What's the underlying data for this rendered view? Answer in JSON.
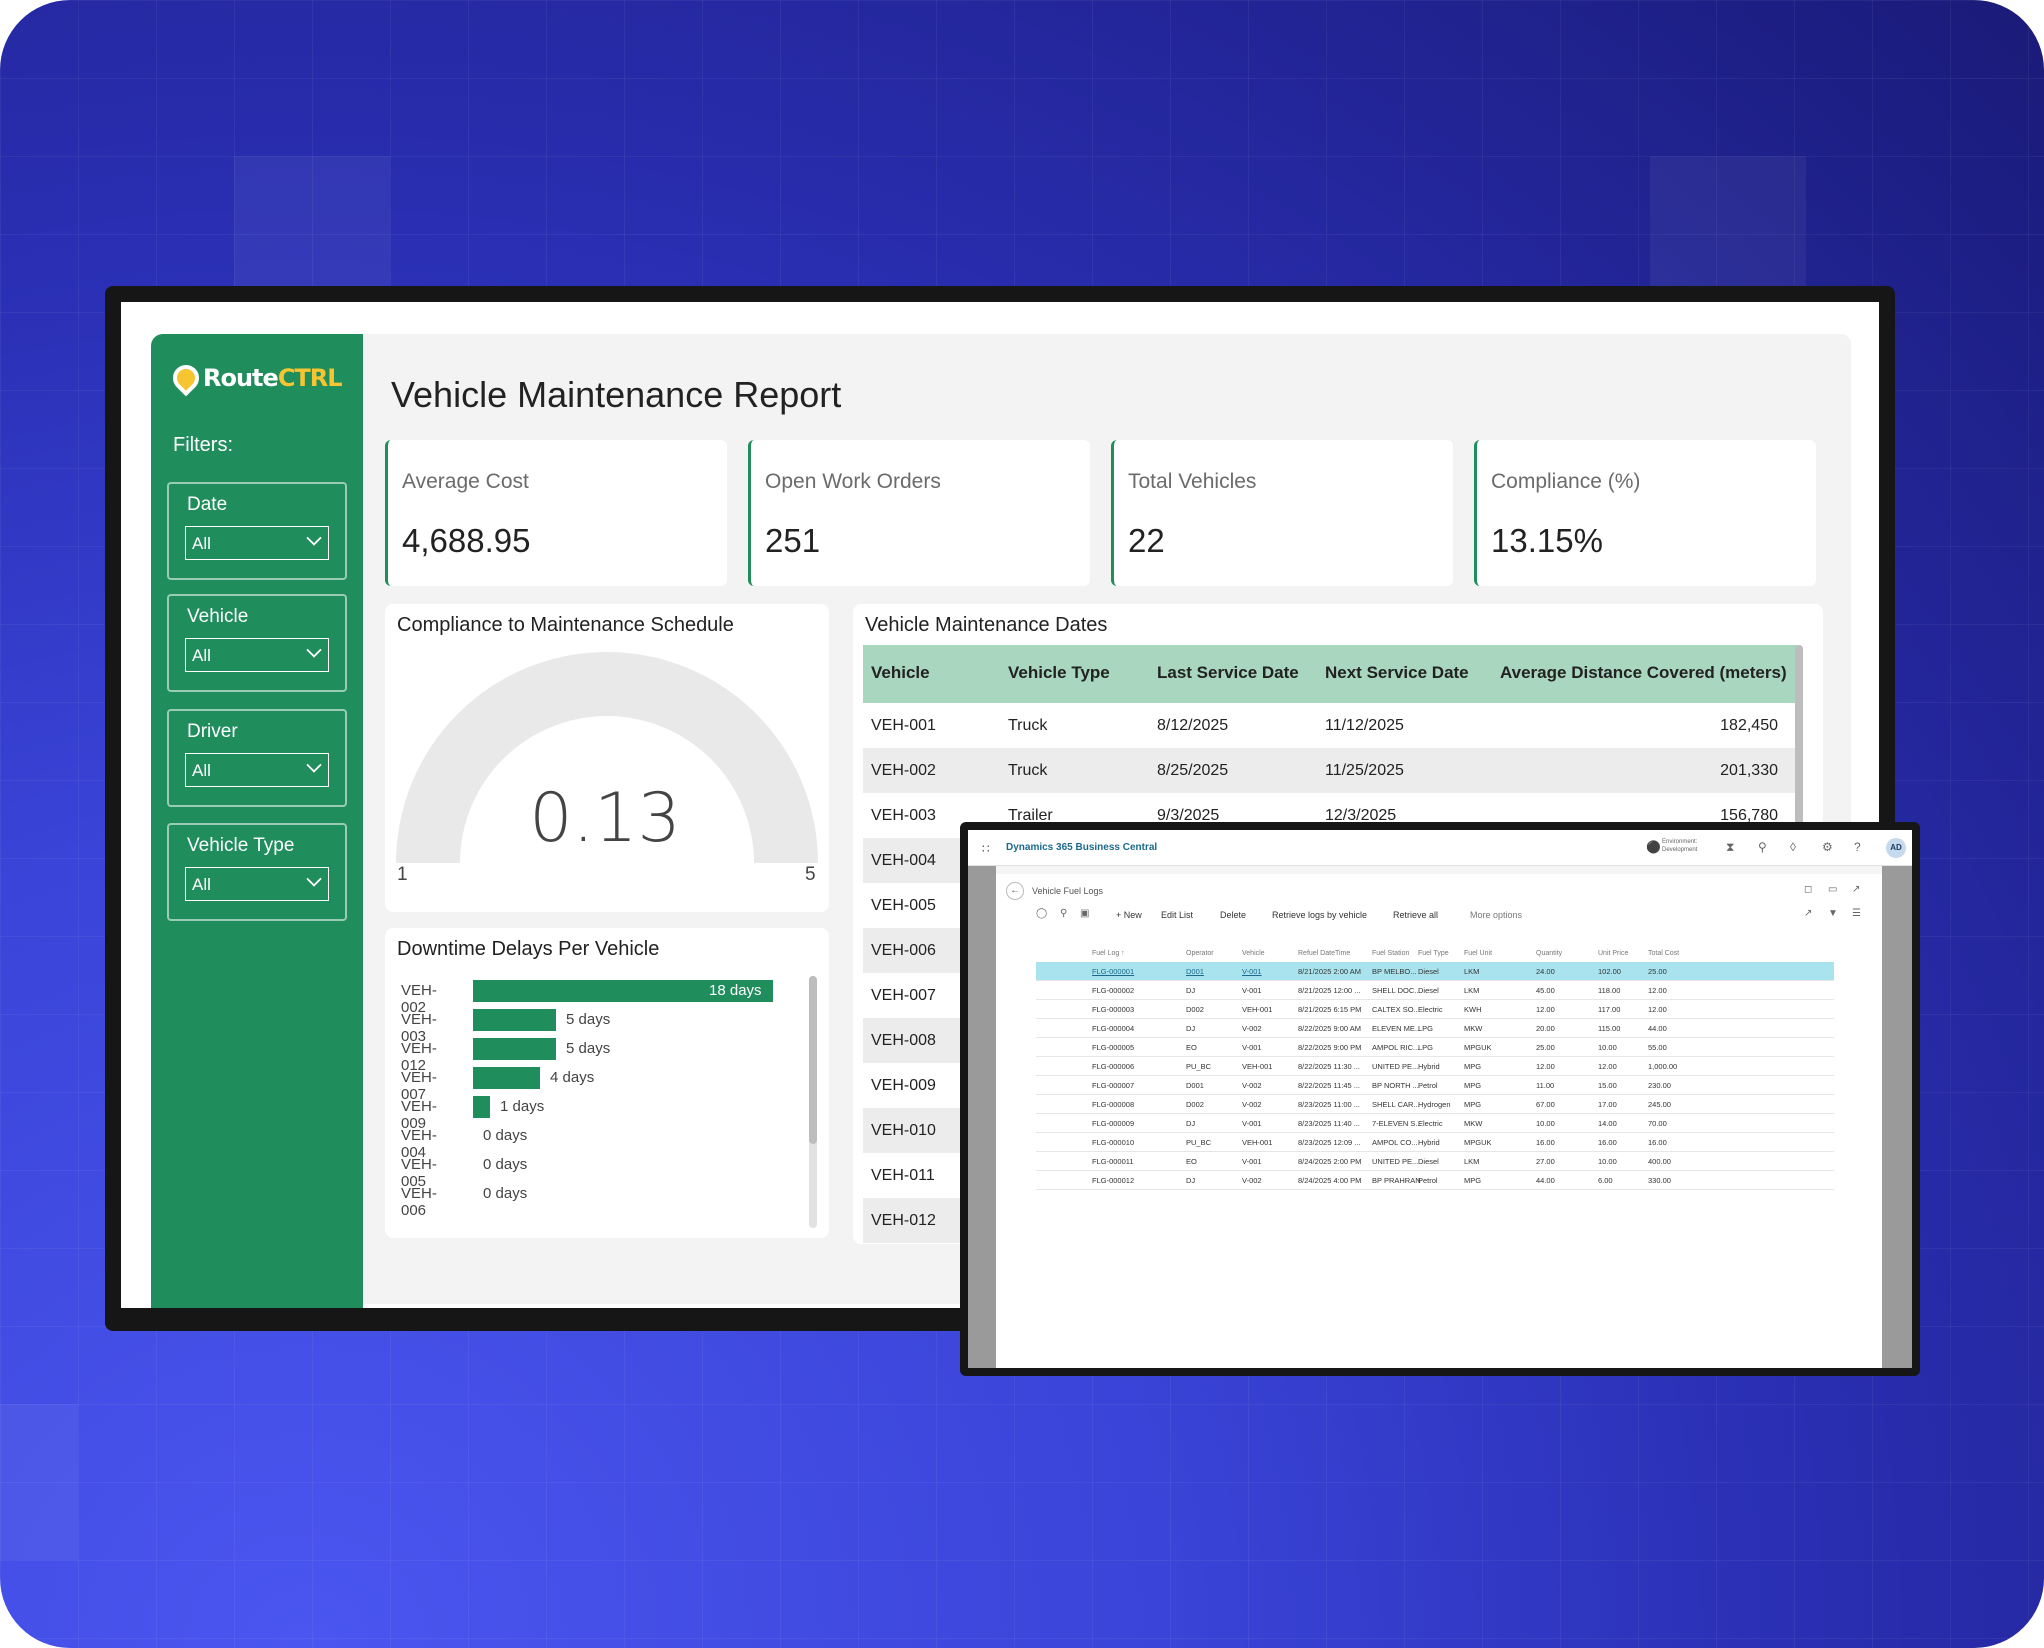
{
  "app": {
    "logo_route": "Route",
    "logo_ctrl": "CTRL",
    "report_title": "Vehicle Maintenance Report"
  },
  "colors": {
    "brand_green": "#1f8d5c",
    "table_header": "#a8d6bf",
    "background_blue": "#2a2fb4",
    "bc_selected_row": "#a9e3ee"
  },
  "filters": {
    "heading": "Filters:",
    "items": [
      {
        "label": "Date",
        "value": "All"
      },
      {
        "label": "Vehicle",
        "value": "All"
      },
      {
        "label": "Driver",
        "value": "All"
      },
      {
        "label": "Vehicle Type",
        "value": "All"
      }
    ]
  },
  "kpis": [
    {
      "label": "Average Cost",
      "value": "4,688.95"
    },
    {
      "label": "Open Work Orders",
      "value": "251"
    },
    {
      "label": "Total Vehicles",
      "value": "22"
    },
    {
      "label": "Compliance (%)",
      "value": "13.15%"
    }
  ],
  "gauge": {
    "title": "Compliance to Maintenance Schedule",
    "value": "0.13",
    "min": "1",
    "max": "5"
  },
  "chart_data": {
    "type": "bar",
    "title": "Downtime Delays Per Vehicle",
    "orientation": "horizontal",
    "categories": [
      "VEH-002",
      "VEH-003",
      "VEH-012",
      "VEH-007",
      "VEH-009",
      "VEH-004",
      "VEH-005",
      "VEH-006"
    ],
    "values": [
      18,
      5,
      5,
      4,
      1,
      0,
      0,
      0
    ],
    "data_labels": [
      "18 days",
      "5 days",
      "5 days",
      "4 days",
      "1 days",
      "0 days",
      "0 days",
      "0 days"
    ],
    "xlim": [
      0,
      18
    ]
  },
  "maintenance_table": {
    "title": "Vehicle Maintenance Dates",
    "columns": [
      "Vehicle",
      "Vehicle Type",
      "Last Service Date",
      "Next Service Date",
      "Average Distance Covered (meters)"
    ],
    "rows": [
      [
        "VEH-001",
        "Truck",
        "8/12/2025",
        "11/12/2025",
        "182,450"
      ],
      [
        "VEH-002",
        "Truck",
        "8/25/2025",
        "11/25/2025",
        "201,330"
      ],
      [
        "VEH-003",
        "Trailer",
        "9/3/2025",
        "12/3/2025",
        "156,780"
      ],
      [
        "VEH-004",
        "",
        "",
        "",
        ""
      ],
      [
        "VEH-005",
        "",
        "",
        "",
        ""
      ],
      [
        "VEH-006",
        "",
        "",
        "",
        ""
      ],
      [
        "VEH-007",
        "",
        "",
        "",
        ""
      ],
      [
        "VEH-008",
        "",
        "",
        "",
        ""
      ],
      [
        "VEH-009",
        "",
        "",
        "",
        ""
      ],
      [
        "VEH-010",
        "",
        "",
        "",
        ""
      ],
      [
        "VEH-011",
        "",
        "",
        "",
        ""
      ],
      [
        "VEH-012",
        "",
        "",
        "",
        ""
      ]
    ]
  },
  "bc": {
    "app_name": "Dynamics 365 Business Central",
    "env": [
      "Environment:",
      "Development"
    ],
    "avatar": "AD",
    "page_name": "Vehicle Fuel Logs",
    "actions": [
      "+ New",
      "Edit List",
      "Delete",
      "Retrieve logs by vehicle",
      "Retrieve all",
      "More options"
    ],
    "columns": [
      "Fuel Log ↑",
      "Operator",
      "Vehicle",
      "Refuel DateTime",
      "Fuel Station",
      "Fuel Type",
      "Fuel Unit",
      "Quantity",
      "Unit Price",
      "Total Cost"
    ],
    "rows": [
      [
        "FLG-000001",
        "D001",
        "V-001",
        "8/21/2025 2:00 AM",
        "BP MELBO...",
        "Diesel",
        "LKM",
        "24.00",
        "102.00",
        "25.00"
      ],
      [
        "FLG-000002",
        "DJ",
        "V-001",
        "8/21/2025 12:00 ...",
        "SHELL DOC...",
        "Diesel",
        "LKM",
        "45.00",
        "118.00",
        "12.00"
      ],
      [
        "FLG-000003",
        "D002",
        "VEH-001",
        "8/21/2025 6:15 PM",
        "CALTEX SO...",
        "Electric",
        "KWH",
        "12.00",
        "117.00",
        "12.00"
      ],
      [
        "FLG-000004",
        "DJ",
        "V-002",
        "8/22/2025 9:00 AM",
        "ELEVEN ME...",
        "LPG",
        "MKW",
        "20.00",
        "115.00",
        "44.00"
      ],
      [
        "FLG-000005",
        "EO",
        "V-001",
        "8/22/2025 9:00 PM",
        "AMPOL RIC...",
        "LPG",
        "MPGUK",
        "25.00",
        "10.00",
        "55.00"
      ],
      [
        "FLG-000006",
        "PU_BC",
        "VEH-001",
        "8/22/2025 11:30 ...",
        "UNITED PE...",
        "Hybrid",
        "MPG",
        "12.00",
        "12.00",
        "1,000.00"
      ],
      [
        "FLG-000007",
        "D001",
        "V-002",
        "8/22/2025 11:45 ...",
        "BP NORTH ...",
        "Petrol",
        "MPG",
        "11.00",
        "15.00",
        "230.00"
      ],
      [
        "FLG-000008",
        "D002",
        "V-002",
        "8/23/2025 11:00 ...",
        "SHELL CAR...",
        "Hydrogen",
        "MPG",
        "67.00",
        "17.00",
        "245.00"
      ],
      [
        "FLG-000009",
        "DJ",
        "V-001",
        "8/23/2025 11:40 ...",
        "7-ELEVEN S...",
        "Electric",
        "MKW",
        "10.00",
        "14.00",
        "70.00"
      ],
      [
        "FLG-000010",
        "PU_BC",
        "VEH-001",
        "8/23/2025 12:09 ...",
        "AMPOL CO...",
        "Hybrid",
        "MPGUK",
        "16.00",
        "16.00",
        "16.00"
      ],
      [
        "FLG-000011",
        "EO",
        "V-001",
        "8/24/2025 2:00 PM",
        "UNITED PE...",
        "Diesel",
        "LKM",
        "27.00",
        "10.00",
        "400.00"
      ],
      [
        "FLG-000012",
        "DJ",
        "V-002",
        "8/24/2025 4:00 PM",
        "BP PRAHRAN",
        "Petrol",
        "MPG",
        "44.00",
        "6.00",
        "330.00"
      ]
    ]
  }
}
